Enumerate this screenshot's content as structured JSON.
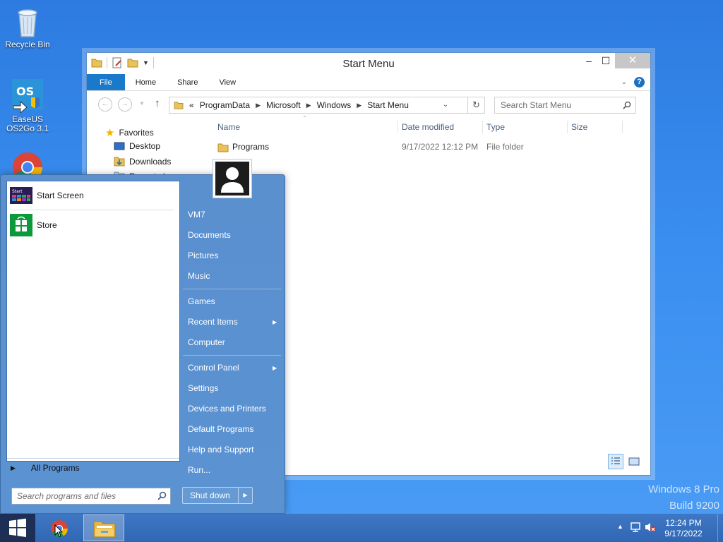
{
  "desktop": {
    "icons": [
      {
        "name": "recycle-bin",
        "label": "Recycle Bin"
      },
      {
        "name": "easeus-os2go",
        "label_line1": "EaseUS",
        "label_line2": "OS2Go 3.1"
      },
      {
        "name": "chrome",
        "label": "Google Chrome"
      }
    ],
    "watermark": {
      "line1": "Windows 8 Pro",
      "line2": "Build 9200"
    }
  },
  "explorer": {
    "title": "Start Menu",
    "ribbon_tabs": [
      "File",
      "Home",
      "Share",
      "View"
    ],
    "path": [
      "ProgramData",
      "Microsoft",
      "Windows",
      "Start Menu"
    ],
    "path_prefix": "«",
    "search_placeholder": "Search Start Menu",
    "nav": {
      "favorites_label": "Favorites",
      "items": [
        "Desktop",
        "Downloads",
        "Recent places"
      ]
    },
    "columns": [
      "Name",
      "Date modified",
      "Type",
      "Size"
    ],
    "rows": [
      {
        "name": "Programs",
        "date_modified": "9/17/2022 12:12 PM",
        "type": "File folder",
        "size": ""
      }
    ]
  },
  "start_menu": {
    "pinned": [
      {
        "label": "Start Screen",
        "icon": "start-screen-icon"
      },
      {
        "label": "Store",
        "icon": "store-icon"
      }
    ],
    "all_programs": "All Programs",
    "search_placeholder": "Search programs and files",
    "right_links": {
      "user": "VM7",
      "documents": "Documents",
      "pictures": "Pictures",
      "music": "Music",
      "games": "Games",
      "recent_items": "Recent Items",
      "computer": "Computer",
      "control_panel": "Control Panel",
      "settings": "Settings",
      "devices_printers": "Devices and Printers",
      "default_programs": "Default Programs",
      "help_support": "Help and Support",
      "run": "Run..."
    },
    "shutdown_label": "Shut down"
  },
  "taskbar": {
    "time": "12:24 PM",
    "date": "9/17/2022"
  },
  "colors": {
    "accent": "#1979ca",
    "start_menu_bg": "#5a92d2",
    "taskbar": "#3270bb"
  }
}
